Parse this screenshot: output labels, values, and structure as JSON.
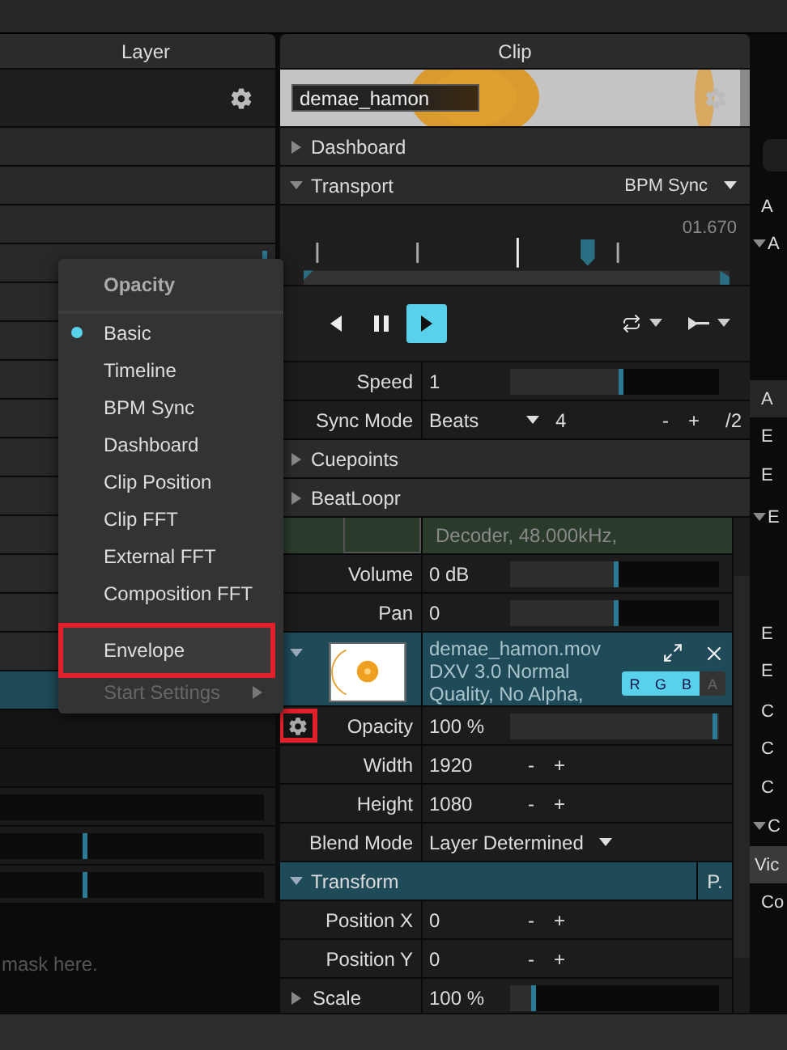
{
  "layer": {
    "title": "Layer",
    "rows": [
      {
        "selected": false
      },
      {
        "selected": false
      },
      {
        "selected": false
      },
      {
        "selected": false,
        "level": 0.97
      },
      {
        "selected": false
      },
      {
        "selected": false
      },
      {
        "selected": false
      },
      {
        "selected": false
      },
      {
        "selected": false
      },
      {
        "selected": false
      },
      {
        "selected": false
      },
      {
        "selected": false
      },
      {
        "selected": false
      },
      {
        "selected": false
      },
      {
        "selected": true
      }
    ],
    "tracks": [
      {
        "kind": "track"
      },
      {
        "kind": "slider",
        "level": 0.33
      },
      {
        "kind": "slider",
        "level": 0.33
      }
    ],
    "hint": "mask here."
  },
  "clip": {
    "title": "Clip",
    "name": "demae_hamon",
    "top_rows": [
      {
        "kind": "section",
        "label": "Dashboard",
        "expanded": false,
        "highlighted": false
      },
      {
        "kind": "section",
        "label": "Transport",
        "expanded": true,
        "highlighted": false,
        "mode": "BPM Sync"
      },
      {
        "kind": "timeline",
        "time": "01.670"
      },
      {
        "kind": "controls",
        "buttons": [
          {
            "kind": "reverse",
            "selected": false
          },
          {
            "kind": "pause",
            "selected": false
          },
          {
            "kind": "play",
            "selected": true
          }
        ]
      },
      {
        "kind": "slider",
        "label": "Speed",
        "value": "1",
        "level": 0.53
      },
      {
        "kind": "sync",
        "label": "Sync Mode",
        "value": "Beats",
        "count": "4",
        "minus": "-",
        "plus": "+",
        "divide": "/2"
      },
      {
        "kind": "section",
        "label": "Cuepoints",
        "expanded": false,
        "highlighted": false
      },
      {
        "kind": "section",
        "label": "BeatLoopr",
        "expanded": false,
        "highlighted": false
      }
    ],
    "body_rows": [
      {
        "kind": "info",
        "text": "Decoder, 48.000kHz,"
      },
      {
        "kind": "slider",
        "label": "Volume",
        "value": "0 dB",
        "level": 0.5
      },
      {
        "kind": "slider",
        "label": "Pan",
        "value": "0",
        "level": 0.5
      },
      {
        "kind": "file",
        "expanded": true,
        "name": "demae_hamon.mov",
        "lines": [
          "DXV 3.0 Normal",
          "Quality, No Alpha,"
        ],
        "channels": [
          {
            "label": "R",
            "on": true
          },
          {
            "label": "G",
            "on": true
          },
          {
            "label": "B",
            "on": true
          },
          {
            "label": "A",
            "on": false
          }
        ]
      },
      {
        "kind": "slider",
        "label": "Opacity",
        "value": "100 %",
        "level": 1,
        "gear": {
          "annotated": true
        }
      },
      {
        "kind": "stepper",
        "label": "Width",
        "value": "1920",
        "minus": "-",
        "plus": "+"
      },
      {
        "kind": "stepper",
        "label": "Height",
        "value": "1080",
        "minus": "-",
        "plus": "+"
      },
      {
        "kind": "dropdown",
        "label": "Blend Mode",
        "value": "Layer Determined"
      },
      {
        "kind": "section",
        "label": "Transform",
        "expanded": true,
        "highlighted": true,
        "action": "P."
      },
      {
        "kind": "stepper",
        "label": "Position X",
        "value": "0",
        "minus": "-",
        "plus": "+"
      },
      {
        "kind": "stepper",
        "label": "Position Y",
        "value": "0",
        "minus": "-",
        "plus": "+"
      },
      {
        "kind": "slider",
        "label": "Scale",
        "value": "100 %",
        "level": 0.11,
        "expanded": false
      }
    ]
  },
  "right": {
    "items": [
      {
        "kind": "field"
      },
      {
        "kind": "text",
        "label": "A",
        "selected": false
      },
      {
        "kind": "section",
        "label": "A",
        "selected": false
      },
      {
        "kind": "text",
        "label": "A",
        "selected": true
      },
      {
        "kind": "text",
        "label": "E",
        "selected": false
      },
      {
        "kind": "text",
        "label": "E",
        "selected": false
      },
      {
        "kind": "section",
        "label": "E",
        "selected": false
      },
      {
        "kind": "text",
        "label": "E",
        "selected": false
      },
      {
        "kind": "text",
        "label": "E",
        "selected": false
      },
      {
        "kind": "text",
        "label": "C",
        "selected": false
      },
      {
        "kind": "text",
        "label": "C",
        "selected": false
      },
      {
        "kind": "text",
        "label": "C",
        "selected": false
      },
      {
        "kind": "section",
        "label": "C",
        "selected": false
      },
      {
        "kind": "tab",
        "label": "Vic",
        "selected": false
      },
      {
        "kind": "text",
        "label": "Co",
        "selected": false
      }
    ]
  },
  "menu": {
    "title": "Opacity",
    "items": [
      {
        "label": "Basic",
        "selected": true,
        "disabled": false,
        "annotated": false,
        "divider": false,
        "submenu": false
      },
      {
        "label": "Timeline",
        "selected": false,
        "disabled": false,
        "annotated": false,
        "divider": false,
        "submenu": false
      },
      {
        "label": "BPM Sync",
        "selected": false,
        "disabled": false,
        "annotated": false,
        "divider": false,
        "submenu": false
      },
      {
        "label": "Dashboard",
        "selected": false,
        "disabled": false,
        "annotated": false,
        "divider": false,
        "submenu": false
      },
      {
        "label": "Clip Position",
        "selected": false,
        "disabled": false,
        "annotated": false,
        "divider": false,
        "submenu": false
      },
      {
        "label": "Clip FFT",
        "selected": false,
        "disabled": false,
        "annotated": false,
        "divider": false,
        "submenu": false
      },
      {
        "label": "External FFT",
        "selected": false,
        "disabled": false,
        "annotated": false,
        "divider": false,
        "submenu": false
      },
      {
        "label": "Composition FFT",
        "selected": false,
        "disabled": false,
        "annotated": false,
        "divider": false,
        "submenu": false
      },
      {
        "label": "Envelope",
        "selected": false,
        "disabled": false,
        "annotated": true,
        "divider": true,
        "submenu": false
      },
      {
        "label": "Start Settings",
        "selected": false,
        "disabled": true,
        "annotated": false,
        "divider": false,
        "submenu": true
      }
    ]
  }
}
